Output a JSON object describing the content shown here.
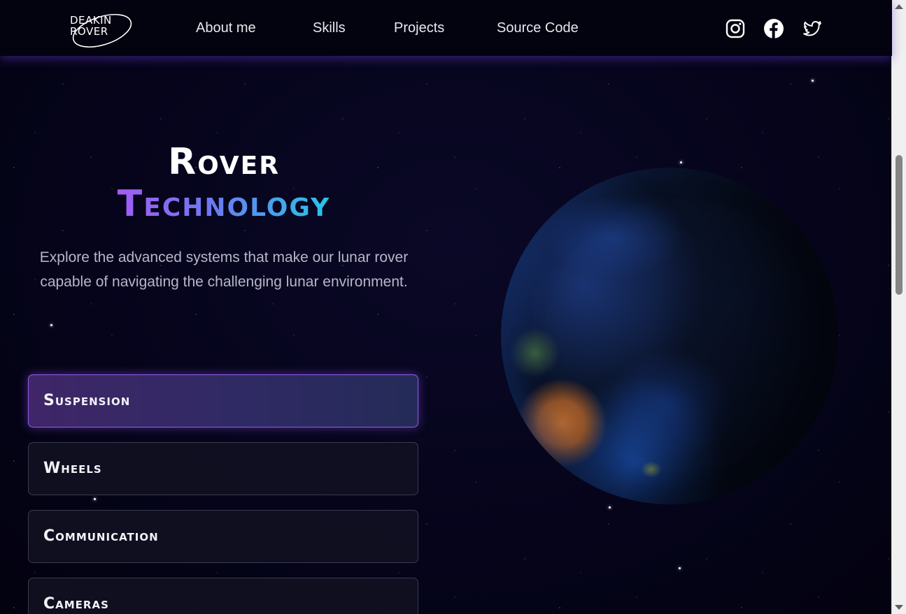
{
  "brand": {
    "logo_line1": "DEAKIN",
    "logo_line2": "ROVER"
  },
  "nav": {
    "links": [
      {
        "label": "About me"
      },
      {
        "label": "Skills"
      },
      {
        "label": "Projects"
      },
      {
        "label": "Source Code"
      }
    ],
    "social": [
      {
        "icon": "instagram-icon"
      },
      {
        "icon": "facebook-icon"
      },
      {
        "icon": "twitter-icon"
      }
    ]
  },
  "hero": {
    "title_line1": "Rover",
    "title_line2": "Technology",
    "subtitle": "Explore the advanced systems that make our lunar rover capable of navigating the challenging lunar environment."
  },
  "tabs": [
    {
      "label": "Suspension",
      "active": true
    },
    {
      "label": "Wheels",
      "active": false
    },
    {
      "label": "Communication",
      "active": false
    },
    {
      "label": "Cameras",
      "active": false
    }
  ],
  "colors": {
    "background": "#05041a",
    "accent_purple": "#a35cf2",
    "accent_cyan": "#27c6e6",
    "active_border": "#8f5ee8"
  }
}
